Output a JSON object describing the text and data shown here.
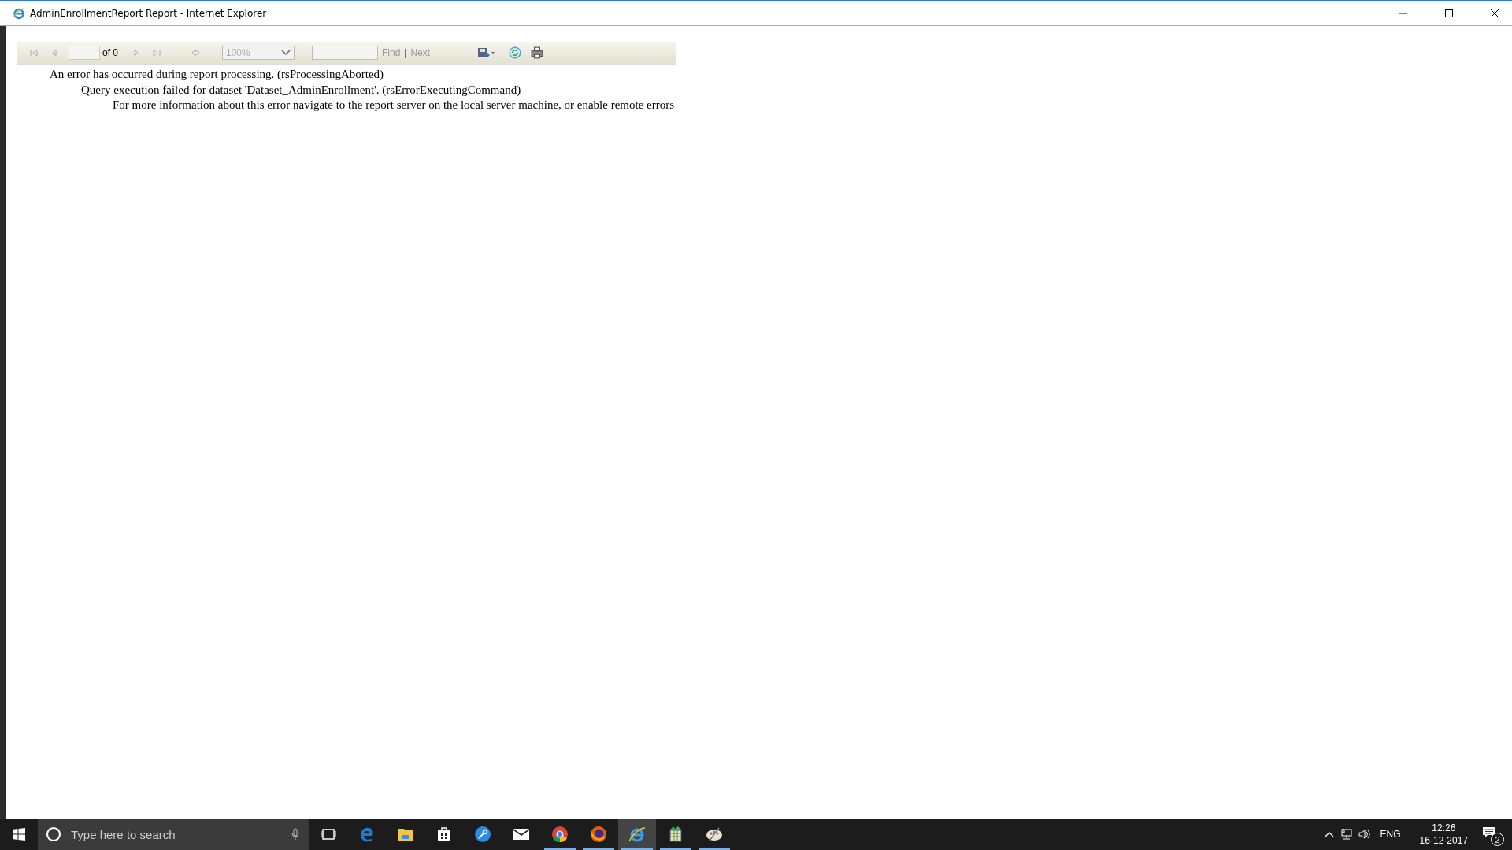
{
  "window": {
    "title": "AdminEnrollmentReport Report - Internet Explorer"
  },
  "toolbar": {
    "page_of": "of 0",
    "zoom": "100%",
    "find": "Find",
    "separator": "|",
    "next": "Next"
  },
  "errors": [
    "An error has occurred during report processing. (rsProcessingAborted)",
    "Query execution failed for dataset 'Dataset_AdminEnrollment'. (rsErrorExecutingCommand)",
    "For more information about this error navigate to the report server on the local server machine, or enable remote errors"
  ],
  "taskbar": {
    "search_placeholder": "Type here to search",
    "apps": [
      {
        "kind": "taskview",
        "running": false,
        "active": false
      },
      {
        "kind": "edge",
        "running": false,
        "active": false
      },
      {
        "kind": "folder",
        "running": false,
        "active": false
      },
      {
        "kind": "store",
        "running": false,
        "active": false
      },
      {
        "kind": "tool",
        "running": false,
        "active": false
      },
      {
        "kind": "mail",
        "running": false,
        "active": false
      },
      {
        "kind": "chrome",
        "running": true,
        "active": false
      },
      {
        "kind": "firefox",
        "running": true,
        "active": false
      },
      {
        "kind": "ie",
        "running": true,
        "active": true
      },
      {
        "kind": "sheet",
        "running": true,
        "active": false
      },
      {
        "kind": "paint",
        "running": true,
        "active": false
      }
    ],
    "language": "ENG",
    "time": "12:26",
    "date": "16-12-2017",
    "notification_count": "2"
  }
}
